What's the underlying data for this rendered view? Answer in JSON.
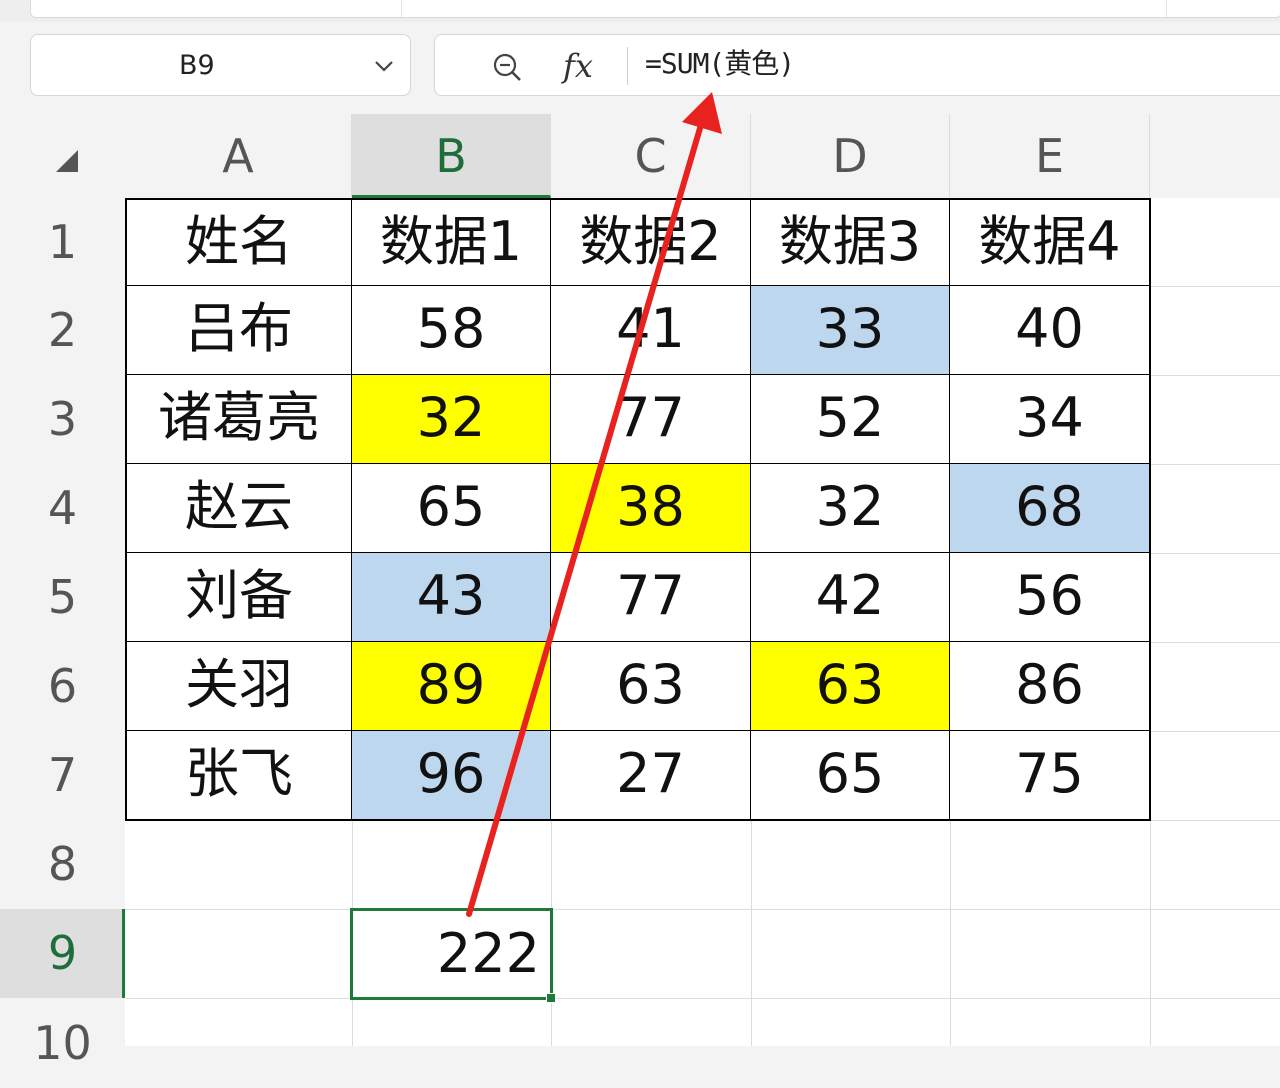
{
  "name_box": {
    "value": "B9"
  },
  "formula_bar": {
    "fx_label": "fx",
    "formula": "=SUM(黄色)"
  },
  "columns": [
    "A",
    "B",
    "C",
    "D",
    "E"
  ],
  "rows": [
    "1",
    "2",
    "3",
    "4",
    "5",
    "6",
    "7",
    "8",
    "9",
    "10"
  ],
  "active_cell": {
    "column": "B",
    "row": "9"
  },
  "table": {
    "headers": [
      "姓名",
      "数据1",
      "数据2",
      "数据3",
      "数据4"
    ],
    "rows": [
      [
        "吕布",
        "58",
        "41",
        "33",
        "40"
      ],
      [
        "诸葛亮",
        "32",
        "77",
        "52",
        "34"
      ],
      [
        "赵云",
        "65",
        "38",
        "32",
        "68"
      ],
      [
        "刘备",
        "43",
        "77",
        "42",
        "56"
      ],
      [
        "关羽",
        "89",
        "63",
        "63",
        "86"
      ],
      [
        "张飞",
        "96",
        "27",
        "65",
        "75"
      ]
    ],
    "fills": [
      [
        "",
        "",
        "",
        "blue",
        ""
      ],
      [
        "",
        "yellow",
        "",
        "",
        ""
      ],
      [
        "",
        "",
        "yellow",
        "",
        "blue"
      ],
      [
        "",
        "blue",
        "",
        "",
        ""
      ],
      [
        "",
        "yellow",
        "",
        "yellow",
        ""
      ],
      [
        "",
        "blue",
        "",
        "",
        ""
      ]
    ]
  },
  "result_cell": {
    "value": "222"
  },
  "colors": {
    "yellow_fill": "#ffff00",
    "blue_fill": "#bdd7ee",
    "selection": "#1f7a3a",
    "arrow": "#e8221e"
  },
  "annotation": {
    "type": "arrow",
    "from": "B9",
    "to": "formula-bar"
  }
}
